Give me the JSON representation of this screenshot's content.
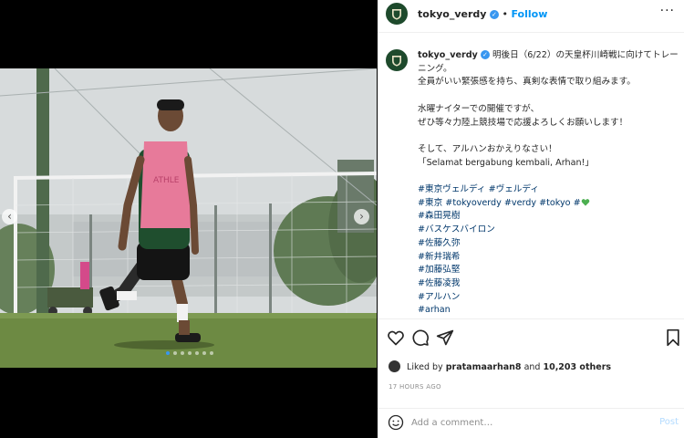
{
  "header": {
    "username": "tokyo_verdy",
    "separator": "•",
    "follow_label": "Follow",
    "more_label": "···"
  },
  "caption": {
    "username": "tokyo_verdy",
    "line1": "明後日（6/22）の天皇杯川崎戦に向けてトレー",
    "line2": "ニング。",
    "line3": "全員がいい緊張感を持ち、真剣な表情で取り組みます。",
    "line4": "水曜ナイターでの開催ですが、",
    "line5": "ぜひ等々力陸上競技場で応援よろしくお願いします！",
    "line6": "そして、アルハンおかえりなさい！",
    "line7": "「Selamat bergabung kembali, Arhan!」",
    "hashtags": [
      "#東京ヴェルディ #ヴェルディ",
      "#東京 #tokyoverdy #verdy #tokyo #",
      "#森田晃樹",
      "#バスケスバイロン",
      "#佐藤久弥",
      "#新井瑞希",
      "#加藤弘堅",
      "#佐藤凌我",
      "#アルハン",
      "#arhan"
    ]
  },
  "likes": {
    "prefix": "Liked by",
    "user": "pratamaarhan8",
    "middle": "and",
    "count": "10,203 others"
  },
  "time": "17 HOURS AGO",
  "comment": {
    "placeholder": "Add a comment…",
    "post_label": "Post"
  },
  "carousel": {
    "prev_label": "‹",
    "next_label": "›",
    "slide_count": 7,
    "active_index": 0
  },
  "colors": {
    "accent": "#0095f6",
    "verified": "#3897f0",
    "club_green": "#1e4a2c",
    "hashtag": "#00376b",
    "post_disabled": "#b3dbff"
  }
}
